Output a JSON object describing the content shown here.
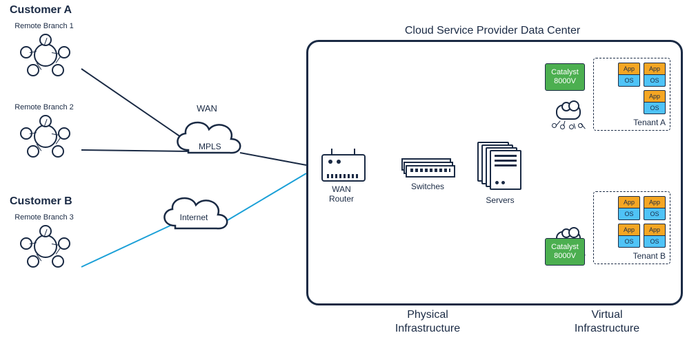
{
  "headings": {
    "customer_a": "Customer A",
    "customer_b": "Customer B",
    "provider": "Cloud Service Provider Data Center"
  },
  "captions": {
    "site1": "Remote Branch 1",
    "site2": "Remote Branch 2",
    "site3": "Remote Branch 3",
    "wan": "WAN",
    "mpls": "MPLS",
    "internet": "Internet",
    "wan_router": "WAN\nRouter",
    "switches": "Switches",
    "servers": "Servers",
    "physical": "Physical\nInfrastructure",
    "virtual": "Virtual\nInfrastructure"
  },
  "catalyst": {
    "label": "Catalyst 8000V"
  },
  "tenant": {
    "a_label": "Tenant A",
    "b_label": "Tenant B",
    "app": "App",
    "os": "OS"
  }
}
